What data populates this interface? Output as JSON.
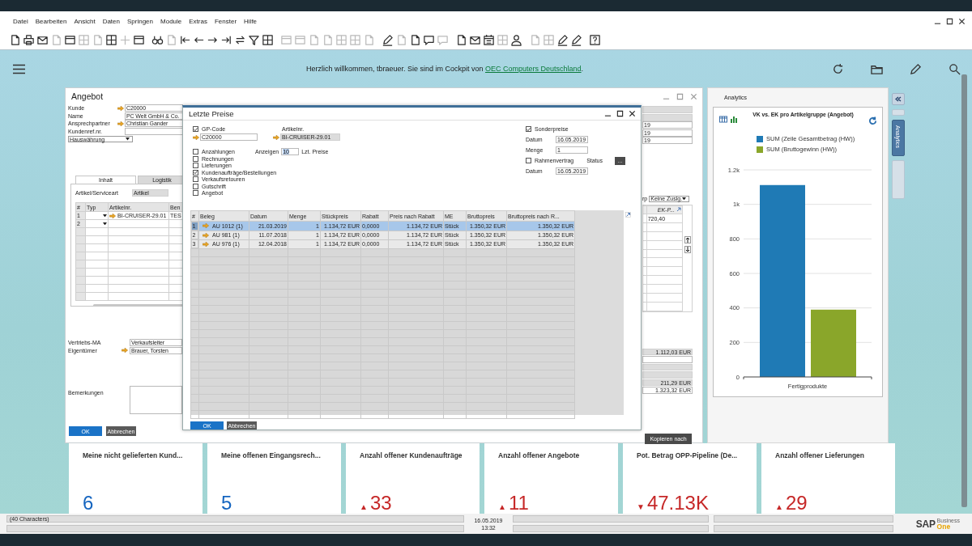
{
  "menu": [
    "Datei",
    "Bearbeiten",
    "Ansicht",
    "Daten",
    "Springen",
    "Module",
    "Extras",
    "Fenster",
    "Hilfe"
  ],
  "toolbar": {
    "groups": [
      {
        "items": [
          {
            "kind": "document",
            "disabled": false
          },
          {
            "kind": "printer",
            "disabled": false
          },
          {
            "kind": "envelope",
            "disabled": false
          },
          {
            "kind": "document",
            "disabled": true
          },
          {
            "kind": "window",
            "disabled": false
          },
          {
            "kind": "grid",
            "disabled": true
          },
          {
            "kind": "document",
            "disabled": true
          },
          {
            "kind": "grid",
            "disabled": false
          },
          {
            "kind": "plus",
            "disabled": true
          },
          {
            "kind": "window",
            "disabled": false
          }
        ]
      },
      {
        "items": [
          {
            "kind": "binoculars",
            "disabled": false
          },
          {
            "kind": "document",
            "disabled": true
          },
          {
            "kind": "first",
            "disabled": false
          },
          {
            "kind": "arrow-left",
            "disabled": false
          },
          {
            "kind": "arrow-right",
            "disabled": false
          },
          {
            "kind": "last",
            "disabled": false
          },
          {
            "kind": "refresh",
            "disabled": false
          },
          {
            "kind": "funnel",
            "disabled": false
          },
          {
            "kind": "grid",
            "disabled": false
          }
        ]
      },
      {
        "items": [
          {
            "kind": "window",
            "disabled": true
          },
          {
            "kind": "window",
            "disabled": true
          },
          {
            "kind": "document",
            "disabled": true
          },
          {
            "kind": "document",
            "disabled": true
          },
          {
            "kind": "grid",
            "disabled": true
          },
          {
            "kind": "grid",
            "disabled": true
          },
          {
            "kind": "document",
            "disabled": true
          }
        ]
      },
      {
        "items": [
          {
            "kind": "pencil",
            "disabled": false
          },
          {
            "kind": "document",
            "disabled": true
          },
          {
            "kind": "document",
            "disabled": false
          },
          {
            "kind": "speech",
            "disabled": false
          },
          {
            "kind": "speech",
            "disabled": true
          }
        ]
      },
      {
        "items": [
          {
            "kind": "document",
            "disabled": false
          },
          {
            "kind": "envelope",
            "disabled": false
          },
          {
            "kind": "calendar",
            "disabled": false
          },
          {
            "kind": "grid",
            "disabled": true
          },
          {
            "kind": "person",
            "disabled": false
          }
        ]
      },
      {
        "items": [
          {
            "kind": "document",
            "disabled": true
          },
          {
            "kind": "grid",
            "disabled": true
          },
          {
            "kind": "pencil",
            "disabled": false
          },
          {
            "kind": "pencil",
            "disabled": false
          }
        ]
      },
      {
        "items": [
          {
            "kind": "question",
            "disabled": false
          }
        ]
      }
    ]
  },
  "cockpit": {
    "welcome": "Herzlich willkommen, tbraeuer. Sie sind im Cockpit von",
    "company_link": "OEC Computers Deutschland",
    "welcome_end": "."
  },
  "quote_window": {
    "title": "Angebot",
    "header_fields": [
      {
        "label": "Kunde",
        "value": "C20000",
        "link": true
      },
      {
        "label": "Name",
        "value": "PC Welt GmbH & Co.",
        "link": false
      },
      {
        "label": "Ansprechpartner",
        "value": "Christian Gander",
        "link": true
      },
      {
        "label": "Kundenref.nr.",
        "link": false
      }
    ],
    "currency_dropdown": "Hauswährung",
    "tabs": [
      {
        "label": "Inhalt",
        "selected": true
      },
      {
        "label": "Logistik",
        "selected": false
      }
    ],
    "item_type": {
      "label": "Artikel/Serviceart",
      "value": "Artikel"
    },
    "table": {
      "columns": [
        "#",
        "Typ",
        "Artikelnr.",
        "Ben"
      ],
      "rows": [
        {
          "number": "1",
          "article": "BI-CRUISER-29.01",
          "column_4": "TES"
        },
        {
          "number": "2"
        }
      ]
    },
    "sales_employee": {
      "label": "Vertriebs-MA",
      "value": "Verkaufsleiter"
    },
    "owner": {
      "label": "Eigentümer",
      "value": "Brauer, Torsten"
    },
    "remarks_label": "Bemerkungen",
    "buttons": [
      "OK",
      "Abbrechen"
    ],
    "right_fields": [
      {
        "readonly": true
      },
      {
        "readonly": true
      },
      {
        "value": "19",
        "readonly": false
      },
      {
        "value": "19",
        "readonly": false
      },
      {
        "value": "19",
        "readonly": false
      }
    ],
    "tax_group": {
      "label": "rp",
      "value": "Keine Zuslg."
    },
    "right_table": {
      "column": "EK-P...",
      "value": "720,40"
    },
    "totals": [
      {
        "value": "1.112,03 EUR",
        "readonly": true
      },
      {
        "readonly": false
      },
      {
        "readonly": true
      },
      {
        "readonly": true
      },
      {
        "value": "211,29 EUR",
        "readonly": true
      },
      {
        "value": "1.323,32 EUR",
        "readonly": false
      }
    ],
    "copy_button": "Kopieren nach"
  },
  "dialog": {
    "title": "Letzte Preise",
    "bp_code": {
      "label": "GP-Code",
      "checked": true,
      "value": "C20000"
    },
    "item": {
      "label": "Artikelnr.",
      "value": "BI-CRUISER-29.01"
    },
    "show": {
      "label": "Anzeigen",
      "value": "10",
      "suffix": "Lzt. Preise"
    },
    "doc_types": [
      {
        "label": "Anzahlungen",
        "checked": false
      },
      {
        "label": "Rechnungen",
        "checked": false
      },
      {
        "label": "Lieferungen",
        "checked": false
      },
      {
        "label": "Kundenaufträge/Bestellungen",
        "checked": true
      },
      {
        "label": "Verkaufsretouren",
        "checked": false
      },
      {
        "label": "Gutschrift",
        "checked": false
      },
      {
        "label": "Angebot",
        "checked": false
      }
    ],
    "special_prices": {
      "label": "Sonderpreise",
      "checked": true
    },
    "date": {
      "label": "Datum",
      "value": "16.05.2019"
    },
    "quantity": {
      "label": "Menge",
      "value": "1"
    },
    "blanket": {
      "label": "Rahmenvertrag",
      "checked": false
    },
    "status": {
      "label": "Status",
      "button": "..."
    },
    "date2": {
      "label": "Datum",
      "value": "16.05.2019"
    },
    "columns": [
      "#",
      "Beleg",
      "Datum",
      "Menge",
      "Stückpreis",
      "Rabatt",
      "Preis nach Rabatt",
      "ME",
      "Bruttopreis",
      "Bruttopreis nach R..."
    ],
    "rows": [
      {
        "selected": true,
        "cells": [
          "1",
          "AU 1012 (1)",
          "21.03.2019",
          "1",
          "1.134,72 EUR",
          "0,0000",
          "1.134,72 EUR",
          "Stück",
          "1.350,32 EUR",
          "1.350,32 EUR"
        ]
      },
      {
        "selected": false,
        "cells": [
          "2",
          "AU 981 (1)",
          "11.07.2018",
          "1",
          "1.134,72 EUR",
          "0,0000",
          "1.134,72 EUR",
          "Stück",
          "1.350,32 EUR",
          "1.350,32 EUR"
        ]
      },
      {
        "selected": false,
        "cells": [
          "3",
          "AU 976 (1)",
          "12.04.2018",
          "1",
          "1.134,72 EUR",
          "0,0000",
          "1.134,72 EUR",
          "Stück",
          "1.350,32 EUR",
          "1.350,32 EUR"
        ]
      }
    ],
    "buttons": [
      "OK",
      "Abbrechen"
    ]
  },
  "analytics": {
    "title": "Analytics",
    "side_tabs": [
      {
        "selected": false
      },
      {
        "label": "Analytics",
        "selected": true
      },
      {
        "selected": false
      }
    ],
    "chart_title": "VK vs. EK pro Artikelgruppe (Angebot)",
    "chart_data": {
      "type": "bar",
      "categories": [
        "Fertigprodukte"
      ],
      "series": [
        {
          "name": "SUM (Zeile Gesamtbetrag (HW))",
          "color": "#1f7ab5",
          "values": [
            1112
          ]
        },
        {
          "name": "SUM (Bruttogewinn (HW))",
          "color": "#8aa62a",
          "values": [
            390
          ]
        }
      ],
      "grid": true,
      "ylim": [
        0,
        1200
      ],
      "yticks": [
        0,
        200,
        400,
        600,
        800,
        {
          "value": 1000,
          "label": "1k"
        },
        {
          "value": 1200,
          "label": "1.2k"
        }
      ]
    }
  },
  "cards": [
    {
      "title": "Meine nicht gelieferten Kund...",
      "value": "6",
      "color": "#1565c0"
    },
    {
      "title": "Meine offenen Eingangsrech...",
      "value": "5",
      "color": "#1565c0"
    },
    {
      "title": "Anzahl offener Kundenaufträge",
      "trend_arrow": "▲",
      "value": "33",
      "color": "#c62828"
    },
    {
      "title": "Anzahl offener Angebote",
      "trend_arrow": "▲",
      "value": "11",
      "color": "#c62828"
    },
    {
      "title": "Pot. Betrag OPP-Pipeline (De...",
      "trend_arrow": "▼",
      "value": "47.13K",
      "color": "#c62828"
    },
    {
      "title": "Anzahl offener Lieferungen",
      "trend_arrow": "▲",
      "value": "29",
      "color": "#c62828"
    }
  ],
  "status_bar": {
    "message": "(40 Characters)",
    "date": "16.05.2019",
    "time": "13:32"
  },
  "logo": {
    "brand": "SAP",
    "line1": "Business",
    "line2": "One"
  }
}
